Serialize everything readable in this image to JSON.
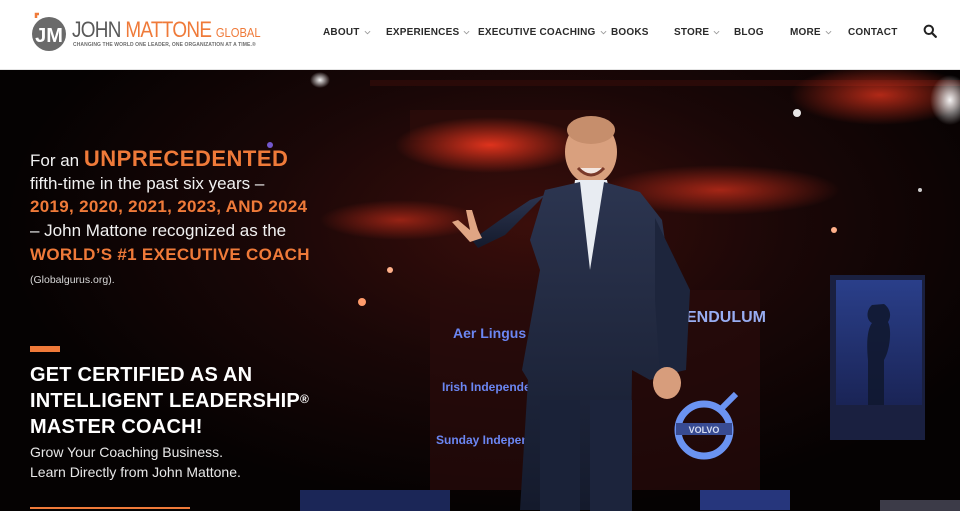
{
  "brand": {
    "mark": "JM",
    "name_first": "JOHN",
    "name_last": "MATTONE",
    "name_suffix": "GLOBAL",
    "tagline": "CHANGING THE WORLD ONE LEADER, ONE ORGANIZATION AT A TIME.®",
    "accent_color": "#ef7a39",
    "gray_color": "#595959"
  },
  "nav": {
    "items": [
      {
        "label": "ABOUT",
        "dropdown": true
      },
      {
        "label": "EXPERIENCES",
        "dropdown": true
      },
      {
        "label": "EXECUTIVE COACHING",
        "dropdown": true
      },
      {
        "label": "BOOKS",
        "dropdown": false
      },
      {
        "label": "STORE",
        "dropdown": true
      },
      {
        "label": "BLOG",
        "dropdown": false
      },
      {
        "label": "MORE",
        "dropdown": true
      },
      {
        "label": "CONTACT",
        "dropdown": false
      }
    ],
    "search_icon": "search-icon"
  },
  "hero": {
    "intro_prefix": "For an",
    "intro_highlight": "UNPRECEDENTED",
    "line2": "fifth-time in the past six years –",
    "years": "2019, 2020, 2021, 2023, AND 2024",
    "line4": "– John Mattone recognized as the",
    "recognition": "WORLD’S #1 EXECUTIVE COACH",
    "source": "(Globalgurus.org).",
    "cert_line1": "GET CERTIFIED AS AN",
    "cert_line2": "INTELLIGENT LEADERSHIP",
    "cert_registered": "®",
    "cert_line3": "MASTER COACH!",
    "sub_line1": "Grow Your Coaching Business.",
    "sub_line2": "Learn Directly from John Mattone.",
    "stage_signs": [
      "Aer Lingus",
      "ENDULUM",
      "Irish Independent",
      "Sunday Independent",
      "VOLVO"
    ]
  }
}
